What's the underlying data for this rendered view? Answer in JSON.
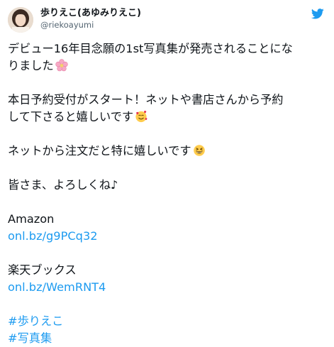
{
  "author": {
    "display_name": "歩りえこ(あゆみりえこ)",
    "handle": "@riekoayumi"
  },
  "icons": {
    "platform": "twitter-bird-icon",
    "avatar": "profile-photo",
    "emoji_1": "cherry-blossom-emoji",
    "emoji_2": "smiling-face-with-hearts-emoji",
    "emoji_3": "grinning-squinting-face-emoji"
  },
  "colors": {
    "link": "#1d9bf0",
    "text": "#0f1419",
    "secondary": "#536471"
  },
  "tweet": {
    "para1_line1": "デビュー16年目念願の1st写真集が発売されることにな",
    "para1_line2": "りました",
    "para2_line1": "本日予約受付がスタート！ネットや書店さんから予約",
    "para2_line2": "して下さると嬉しいです",
    "para3": "ネットから注文だと特に嬉しいです",
    "para4": "皆さま、よろしくね♪",
    "store1_name": "Amazon",
    "store1_link": "onl.bz/g9PCq32",
    "store2_name": "楽天ブックス",
    "store2_link": "onl.bz/WemRNT4",
    "hashtag1": "#歩りえこ",
    "hashtag2": "#写真集"
  }
}
